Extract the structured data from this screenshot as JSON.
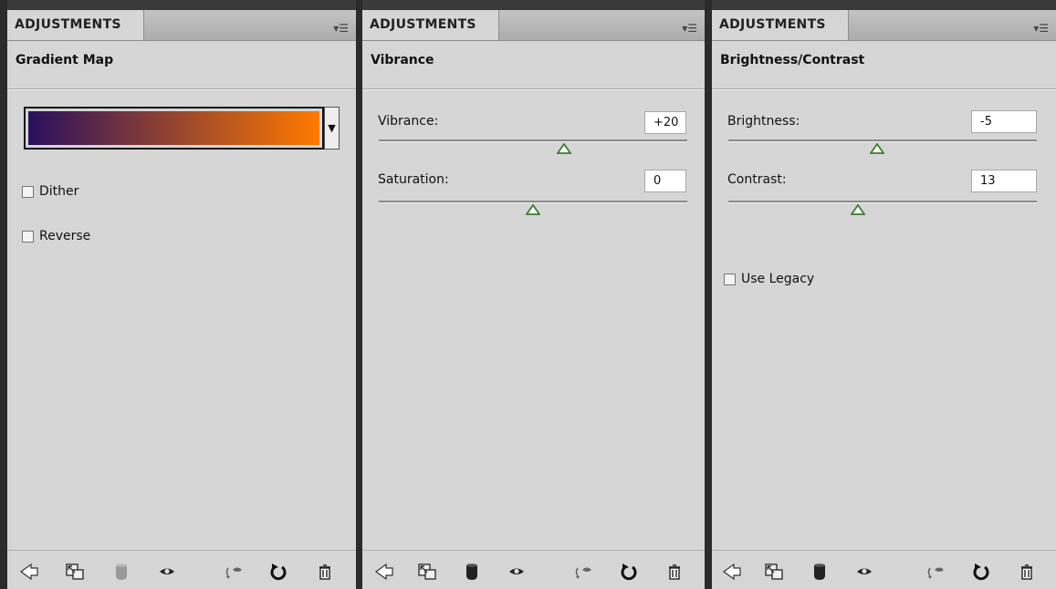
{
  "panels": {
    "gradient_map": {
      "tab_label": "ADJUSTMENTS",
      "title": "Gradient Map",
      "gradient_colors": [
        "#2a0f5e",
        "#ff7a00"
      ],
      "dither_label": "Dither",
      "dither_checked": false,
      "reverse_label": "Reverse",
      "reverse_checked": false,
      "mask_icon_disabled": true
    },
    "vibrance": {
      "tab_label": "ADJUSTMENTS",
      "title": "Vibrance",
      "vibrance_label": "Vibrance:",
      "vibrance_value": "+20",
      "vibrance_slider": {
        "value": 20,
        "min": -100,
        "max": 100
      },
      "saturation_label": "Saturation:",
      "saturation_value": "0",
      "saturation_slider": {
        "value": 0,
        "min": -100,
        "max": 100
      }
    },
    "brightness_contrast": {
      "tab_label": "ADJUSTMENTS",
      "title": "Brightness/Contrast",
      "brightness_label": "Brightness:",
      "brightness_value": "-5",
      "brightness_slider": {
        "value": -5,
        "min": -150,
        "max": 150
      },
      "contrast_label": "Contrast:",
      "contrast_value": "13",
      "contrast_slider": {
        "value": 13,
        "min": -50,
        "max": 100
      },
      "legacy_label": "Use Legacy",
      "legacy_checked": false
    }
  },
  "menu_icon": "panel-menu-icon",
  "footer_icons": [
    "back-arrow-icon",
    "expand-view-icon",
    "clip-to-layer-icon",
    "eye-icon",
    "view-previous-state-icon",
    "reset-icon",
    "trash-icon"
  ],
  "colors": {
    "panel_bg": "#d6d6d6",
    "slider_thumb": "#3d7a2e"
  }
}
